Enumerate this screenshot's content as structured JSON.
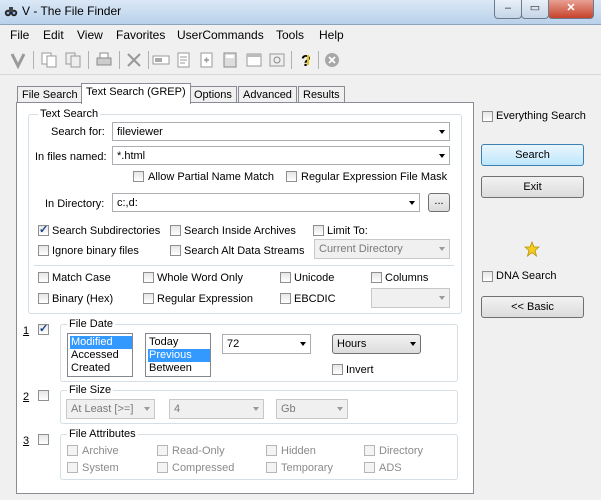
{
  "window": {
    "title": "V - The File Finder"
  },
  "menu": [
    "File",
    "Edit",
    "View",
    "Favorites",
    "UserCommands",
    "Tools",
    "Help"
  ],
  "toolbar_icons": [
    "app-v-icon",
    "copy-icon",
    "copy-to-icon",
    "print-icon",
    "delete-icon",
    "rename-icon",
    "edit-icon",
    "properties-icon",
    "calculator-icon",
    "preview-icon",
    "help-icon",
    "stop-icon"
  ],
  "tabs": [
    "File Search",
    "Text Search (GREP)",
    "Options",
    "Advanced",
    "Results"
  ],
  "text_search": {
    "group_title": "Text Search",
    "search_for_label": "Search for:",
    "search_for_value": "fileviewer",
    "in_files_label": "In files named:",
    "in_files_value": "*.html",
    "allow_partial": "Allow Partial Name Match",
    "regex_mask": "Regular Expression File Mask",
    "in_directory_label": "In Directory:",
    "in_directory_value": "c:,d:",
    "browse": "...",
    "search_subdirs": "Search Subdirectories",
    "search_archives": "Search Inside Archives",
    "limit_to": "Limit To:",
    "ignore_binary": "Ignore binary files",
    "search_ads": "Search Alt Data Streams",
    "limit_value": "Current Directory",
    "match_case": "Match Case",
    "whole_word": "Whole Word Only",
    "unicode": "Unicode",
    "columns": "Columns",
    "binary_hex": "Binary (Hex)",
    "regex": "Regular Expression",
    "ebcdic": "EBCDIC"
  },
  "file_date": {
    "num": "1",
    "title": "File Date",
    "types": [
      "Modified",
      "Accessed",
      "Created"
    ],
    "when": [
      "Today",
      "Previous",
      "Between"
    ],
    "value": "72",
    "unit": "Hours",
    "invert": "Invert"
  },
  "file_size": {
    "num": "2",
    "title": "File Size",
    "op": "At Least [>=]",
    "value": "4",
    "unit": "Gb"
  },
  "file_attributes": {
    "num": "3",
    "title": "File Attributes",
    "items": [
      "Archive",
      "Read-Only",
      "Hidden",
      "Directory",
      "System",
      "Compressed",
      "Temporary",
      "ADS"
    ]
  },
  "right_panel": {
    "everything_search": "Everything Search",
    "search": "Search",
    "exit": "Exit",
    "dna_search": "DNA Search",
    "basic": "<< Basic"
  }
}
